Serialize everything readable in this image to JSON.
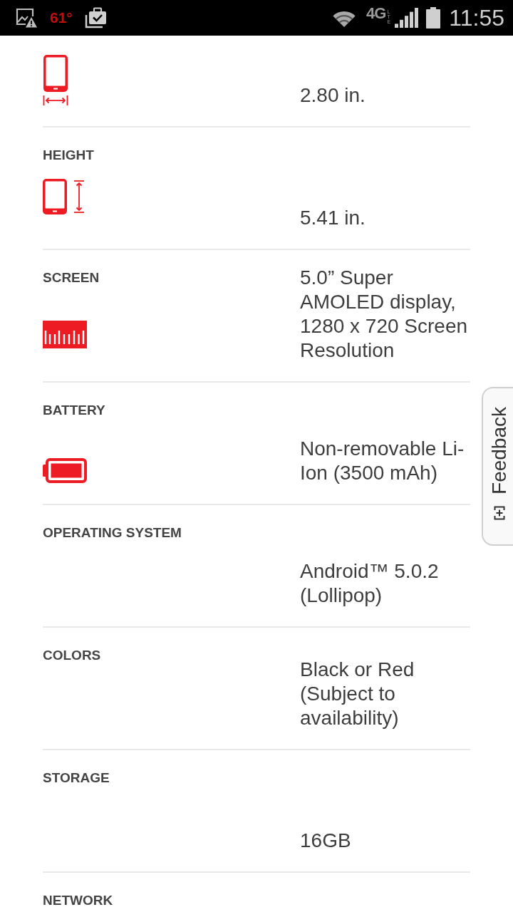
{
  "status_bar": {
    "temperature": "61°",
    "network_type": "4G",
    "network_subtype": "LTE",
    "time": "11:55"
  },
  "specs": [
    {
      "kind": "width",
      "value": "2.80 in."
    },
    {
      "label": "HEIGHT",
      "kind": "height",
      "value": "5.41 in."
    },
    {
      "label": "SCREEN",
      "kind": "ruler",
      "value": "5.0” Super AMOLED display, 1280 x 720 Screen Resolution"
    },
    {
      "label": "BATTERY",
      "kind": "battery",
      "value": "Non-removable Li-Ion (3500 mAh)"
    },
    {
      "label": "OPERATING SYSTEM",
      "kind": "plain",
      "value": "Android™ 5.0.2 (Lollipop)"
    },
    {
      "label": "COLORS",
      "kind": "plain",
      "value": "Black or Red (Subject to availability)"
    },
    {
      "label": "STORAGE",
      "kind": "plain",
      "value": "16GB"
    },
    {
      "label": "NETWORK",
      "kind": "plain"
    }
  ],
  "feedback_tab": {
    "label": "Feedback"
  }
}
